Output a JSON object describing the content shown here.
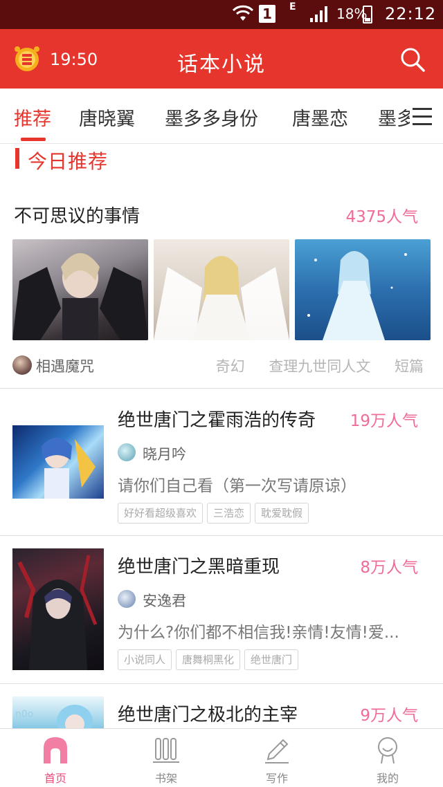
{
  "status_bar": {
    "sim_slot": "1",
    "network_type": "E",
    "battery_percent": "18%",
    "time": "22:12"
  },
  "header": {
    "alarm_time": "19:50",
    "title": "话本小说"
  },
  "tabs": [
    {
      "label": "推荐",
      "active": true
    },
    {
      "label": "唐晓翼",
      "active": false
    },
    {
      "label": "墨多多身份",
      "active": false
    },
    {
      "label": "唐墨恋",
      "active": false
    },
    {
      "label": "墨多",
      "active": false
    }
  ],
  "section": {
    "title": "今日推荐"
  },
  "featured": {
    "title": "不可思议的事情",
    "popularity": "4375人气",
    "author": "相遇魔咒",
    "tags": [
      "奇幻",
      "查理九世同人文",
      "短篇"
    ]
  },
  "items": [
    {
      "title": "绝世唐门之霍雨浩的传奇",
      "popularity": "19万人气",
      "author": "晓月吟",
      "desc": "请你们自己看（第一次写请原谅）",
      "tags": [
        "好好看超级喜欢",
        "三浩恋",
        "耽爱耽假"
      ]
    },
    {
      "title": "绝世唐门之黑暗重现",
      "popularity": "8万人气",
      "author": "安逸君",
      "desc": "为什么?你们都不相信我!亲情!友情!爱...",
      "tags": [
        "小说同人",
        "唐舞桐黑化",
        "绝世唐门"
      ]
    },
    {
      "title": "绝世唐门之极北的主宰",
      "popularity": "9万人气"
    }
  ],
  "bottom_nav": [
    {
      "label": "首页",
      "icon": "home-icon",
      "active": true
    },
    {
      "label": "书架",
      "icon": "bookshelf-icon",
      "active": false
    },
    {
      "label": "写作",
      "icon": "pencil-icon",
      "active": false
    },
    {
      "label": "我的",
      "icon": "profile-icon",
      "active": false
    }
  ],
  "colors": {
    "brand_red": "#e5352c",
    "status_bar": "#5b0c0c",
    "popularity_pink": "#f06a9a",
    "nav_active": "#e84b7a"
  }
}
